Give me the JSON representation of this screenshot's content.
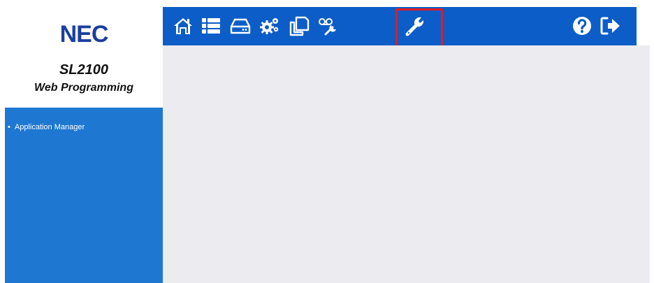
{
  "brand": {
    "logo_text": "NEC",
    "product_title": "SL2100",
    "product_subtitle": "Web Programming"
  },
  "sidebar": {
    "items": [
      {
        "label": "Application Manager"
      }
    ]
  },
  "toolbar": {
    "icons": [
      "home-icon",
      "list-icon",
      "drive-icon",
      "settings-gears-icon",
      "copy-icon",
      "voicemail-icon",
      "wrench-icon",
      "help-icon",
      "logout-icon"
    ],
    "active_icon": "wrench-icon"
  },
  "colors": {
    "toolbar_bg": "#0c5dc7",
    "sidebar_nav_bg": "#1e78d2",
    "content_bg": "#ecebf0",
    "logo": "#1c3f9e",
    "highlight": "#e21b22"
  }
}
